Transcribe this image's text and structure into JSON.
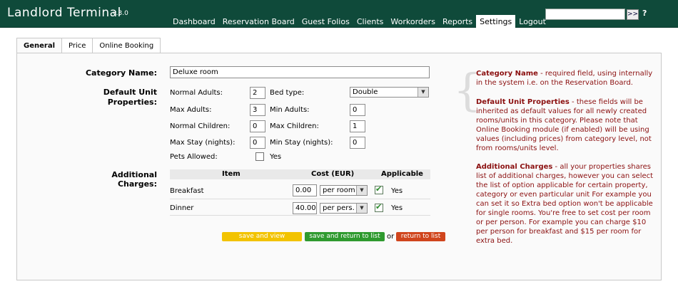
{
  "app": {
    "title": "Landlord Terminal",
    "version": "v.3.0"
  },
  "nav": [
    {
      "label": "Dashboard"
    },
    {
      "label": "Reservation Board"
    },
    {
      "label": "Guest Folios"
    },
    {
      "label": "Clients"
    },
    {
      "label": "Workorders"
    },
    {
      "label": "Reports"
    },
    {
      "label": "Settings",
      "active": true
    },
    {
      "label": "Logout"
    }
  ],
  "search": {
    "go_label": ">>",
    "help_label": "?",
    "value": ""
  },
  "tabs": [
    {
      "label": "General",
      "active": true
    },
    {
      "label": "Price"
    },
    {
      "label": "Online Booking"
    }
  ],
  "form": {
    "category_name_label": "Category Name:",
    "category_name_value": "Deluxe room",
    "default_unit_label": "Default Unit Properties:",
    "normal_adults_label": "Normal Adults:",
    "normal_adults_value": "2",
    "bed_type_label": "Bed type:",
    "bed_type_value": "Double",
    "max_adults_label": "Max Adults:",
    "max_adults_value": "3",
    "min_adults_label": "Min Adults:",
    "min_adults_value": "0",
    "normal_children_label": "Normal Children:",
    "normal_children_value": "0",
    "max_children_label": "Max Children:",
    "max_children_value": "1",
    "max_stay_label": "Max Stay (nights):",
    "max_stay_value": "0",
    "min_stay_label": "Min Stay (nights):",
    "min_stay_value": "0",
    "pets_label": "Pets Allowed:",
    "pets_value_label": "Yes",
    "additional_charges_label": "Additional Charges:"
  },
  "charges": {
    "headers": {
      "item": "Item",
      "cost": "Cost (EUR)",
      "applicable": "Applicable"
    },
    "rows": [
      {
        "item": "Breakfast",
        "cost": "0.00",
        "unit": "per room",
        "applicable": "Yes"
      },
      {
        "item": "Dinner",
        "cost": "40.00",
        "unit": "per pers.",
        "applicable": "Yes"
      }
    ]
  },
  "buttons": {
    "save_view": "save and view",
    "save_return": "save and return to list",
    "or": "or",
    "return": "return to list",
    "colors": {
      "save_view": "#f2c300",
      "save_return": "#2f9a2f",
      "return": "#d0451d"
    }
  },
  "help": {
    "p1_title": "Category Name",
    "p1_text": " - required field, using internally in the system i.e. on the Reservation Board.",
    "p2_title": "Default Unit Properties",
    "p2_text": " - these fields will be inherited as default values for all newly created rooms/units in this category. Please note that Online Booking module (if enabled) will be using values (including prices) from category level, not from rooms/units level.",
    "p3_title": "Additional Charges",
    "p3_text": " - all your properties shares list of additional charges, however you can select the list of option applicable for certain property, category or even particular unit For example you can set it so Extra bed option won't be applicable for single rooms. You're free to set cost per room or per person. For example you can charge $10 per person for breakfast and $15 per room for extra bed."
  }
}
